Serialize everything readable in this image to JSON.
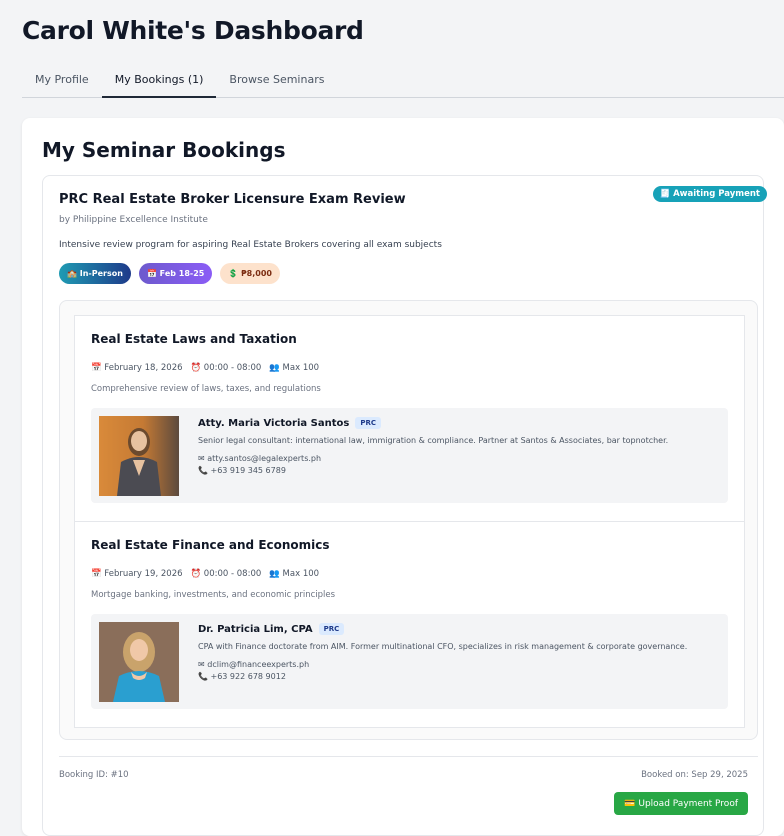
{
  "header": {
    "title": "Carol White's Dashboard"
  },
  "tabs": [
    {
      "label": "My Profile"
    },
    {
      "label": "My Bookings (1)"
    },
    {
      "label": "Browse Seminars"
    }
  ],
  "bookings_section": {
    "title": "My Seminar Bookings"
  },
  "booking": {
    "status": "🧾 Awaiting Payment",
    "title": "PRC Real Estate Broker Licensure Exam Review",
    "organizer": "by Philippine Excellence Institute",
    "description": "Intensive review program for aspiring Real Estate Brokers covering all exam subjects",
    "pills": {
      "mode": "🏫 In-Person",
      "dates": "📅 Feb 18-25",
      "price": "💲 ₱8,000"
    },
    "sessions": [
      {
        "title": "Real Estate Laws and Taxation",
        "date": "📅 February 18, 2026",
        "time": "⏰ 00:00 - 08:00",
        "capacity": "👥 Max 100",
        "description": "Comprehensive review of laws, taxes, and regulations",
        "speaker": {
          "name": "Atty. Maria Victoria Santos",
          "badge": "PRC",
          "bio": "Senior legal consultant: international law, immigration & compliance. Partner at Santos & Associates, bar topnotcher.",
          "email": "✉ atty.santos@legalexperts.ph",
          "phone": "📞 +63 919 345 6789"
        }
      },
      {
        "title": "Real Estate Finance and Economics",
        "date": "📅 February 19, 2026",
        "time": "⏰ 00:00 - 08:00",
        "capacity": "👥 Max 100",
        "description": "Mortgage banking, investments, and economic principles",
        "speaker": {
          "name": "Dr. Patricia Lim, CPA",
          "badge": "PRC",
          "bio": "CPA with Finance doctorate from AIM. Former multinational CFO, specializes in risk management & corporate governance.",
          "email": "✉ dclim@financeexperts.ph",
          "phone": "📞 +63 922 678 9012"
        }
      }
    ],
    "booking_id": "Booking ID: #10",
    "booked_on": "Booked on: Sep 29, 2025",
    "upload_button": "💳 Upload Payment Proof"
  },
  "colors": {
    "status_badge": "#17a2b8",
    "upload_button": "#28a745",
    "active_tab_underline": "#1f2937"
  }
}
